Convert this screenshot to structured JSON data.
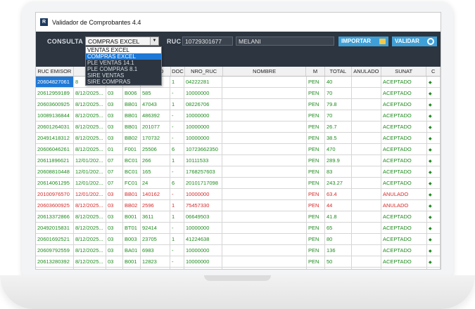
{
  "window": {
    "title": "Validador de Comprobantes 4.4",
    "icon": "app-logo-icon"
  },
  "toolbar": {
    "consulta_label": "CONSULTA",
    "consulta_value": "COMPRAS EXCEL",
    "ruc_label": "RUC",
    "ruc_value": "10729301677",
    "name_value": "MELANI",
    "importar_label": "IMPORTAR",
    "validar_label": "VALIDAR"
  },
  "dropdown": {
    "options": [
      "VENTAS EXCEL",
      "COMPRAS EXCEL",
      "PLE VENTAS 14.1",
      "PLE COMPRAS 8.1",
      "SIRE VENTAS",
      "SIRE COMPRAS"
    ],
    "selected_index": 1
  },
  "table": {
    "columns": [
      "RUC EMISOR",
      "F",
      "",
      "",
      "MERO",
      "DOC",
      "NRO_RUC",
      "NOMBRE",
      "M",
      "TOTAL",
      "ANULADO",
      "SUNAT",
      "C"
    ],
    "rows": [
      [
        "20604827061",
        "8",
        "",
        "",
        "",
        "1",
        "04222281",
        "",
        "PEN",
        "40",
        "",
        "ACEPTADO",
        "ok"
      ],
      [
        "20612959189",
        "8/12/2025...",
        "03",
        "B006",
        "585",
        "-",
        "10000000",
        "",
        "PEN",
        "70",
        "",
        "ACEPTADO",
        "ok"
      ],
      [
        "20603600925",
        "8/12/2025...",
        "03",
        "BB01",
        "47043",
        "1",
        "08226706",
        "",
        "PEN",
        "79.8",
        "",
        "ACEPTADO",
        "ok"
      ],
      [
        "10089136844",
        "8/12/2025...",
        "03",
        "BB01",
        "486392",
        "-",
        "10000000",
        "",
        "PEN",
        "70",
        "",
        "ACEPTADO",
        "ok"
      ],
      [
        "20601264031",
        "8/12/2025...",
        "03",
        "BB01",
        "201077",
        "-",
        "10000000",
        "",
        "PEN",
        "26.7",
        "",
        "ACEPTADO",
        "ok"
      ],
      [
        "20491418312",
        "8/12/2025...",
        "03",
        "BB02",
        "170732",
        "-",
        "10000000",
        "",
        "PEN",
        "38.5",
        "",
        "ACEPTADO",
        "ok"
      ],
      [
        "20606046261",
        "8/12/2025...",
        "01",
        "F001",
        "25506",
        "6",
        "10723662350",
        "",
        "PEN",
        "470",
        "",
        "ACEPTADO",
        "ok"
      ],
      [
        "20611896621",
        "12/01/202...",
        "07",
        "BC01",
        "266",
        "1",
        "10111533",
        "",
        "PEN",
        "289.9",
        "",
        "ACEPTADO",
        "ok"
      ],
      [
        "20608810448",
        "12/01/202...",
        "07",
        "BC01",
        "165",
        "-",
        "1768257603",
        "",
        "PEN",
        "83",
        "",
        "ACEPTADO",
        "ok"
      ],
      [
        "20614061295",
        "12/01/202...",
        "07",
        "FC01",
        "24",
        "6",
        "20101717098",
        "",
        "PEN",
        "243.27",
        "",
        "ACEPTADO",
        "ok"
      ],
      [
        "20100976570",
        "12/01/202...",
        "03",
        "BB01",
        "140162",
        "-",
        "10000000",
        "",
        "PEN",
        "63.4",
        "",
        "ANULADO",
        "bad"
      ],
      [
        "20603600925",
        "8/12/2025...",
        "03",
        "BB02",
        "2596",
        "1",
        "75457330",
        "",
        "PEN",
        "44",
        "",
        "ANULADO",
        "bad"
      ],
      [
        "20613372866",
        "8/12/2025...",
        "03",
        "B001",
        "3611",
        "1",
        "06649503",
        "",
        "PEN",
        "41.8",
        "",
        "ACEPTADO",
        "ok"
      ],
      [
        "20492015831",
        "8/12/2025...",
        "03",
        "BT01",
        "92414",
        "-",
        "10000000",
        "",
        "PEN",
        "65",
        "",
        "ACEPTADO",
        "ok"
      ],
      [
        "20601692521",
        "8/12/2025...",
        "03",
        "B003",
        "23705",
        "1",
        "41224638",
        "",
        "PEN",
        "80",
        "",
        "ACEPTADO",
        "ok"
      ],
      [
        "20609792559",
        "8/12/2025...",
        "03",
        "BA01",
        "6983",
        "-",
        "10000000",
        "",
        "PEN",
        "136",
        "",
        "ACEPTADO",
        "ok"
      ],
      [
        "20613280392",
        "8/12/2025...",
        "03",
        "B001",
        "12823",
        "-",
        "10000000",
        "",
        "PEN",
        "50",
        "",
        "ACEPTADO",
        "ok"
      ],
      [
        "20516138484",
        "8/12/2025...",
        "03",
        "BB01",
        "83783",
        "-",
        "10000000",
        "",
        "PEN",
        "25",
        "",
        "ACEPTADO",
        "ok"
      ]
    ]
  },
  "colors": {
    "accepted": "#1f8a1f",
    "annulled": "#d42a2a",
    "toolbar": "#2c3540",
    "button": "#3fa0d8",
    "selection": "#1e78d6"
  }
}
